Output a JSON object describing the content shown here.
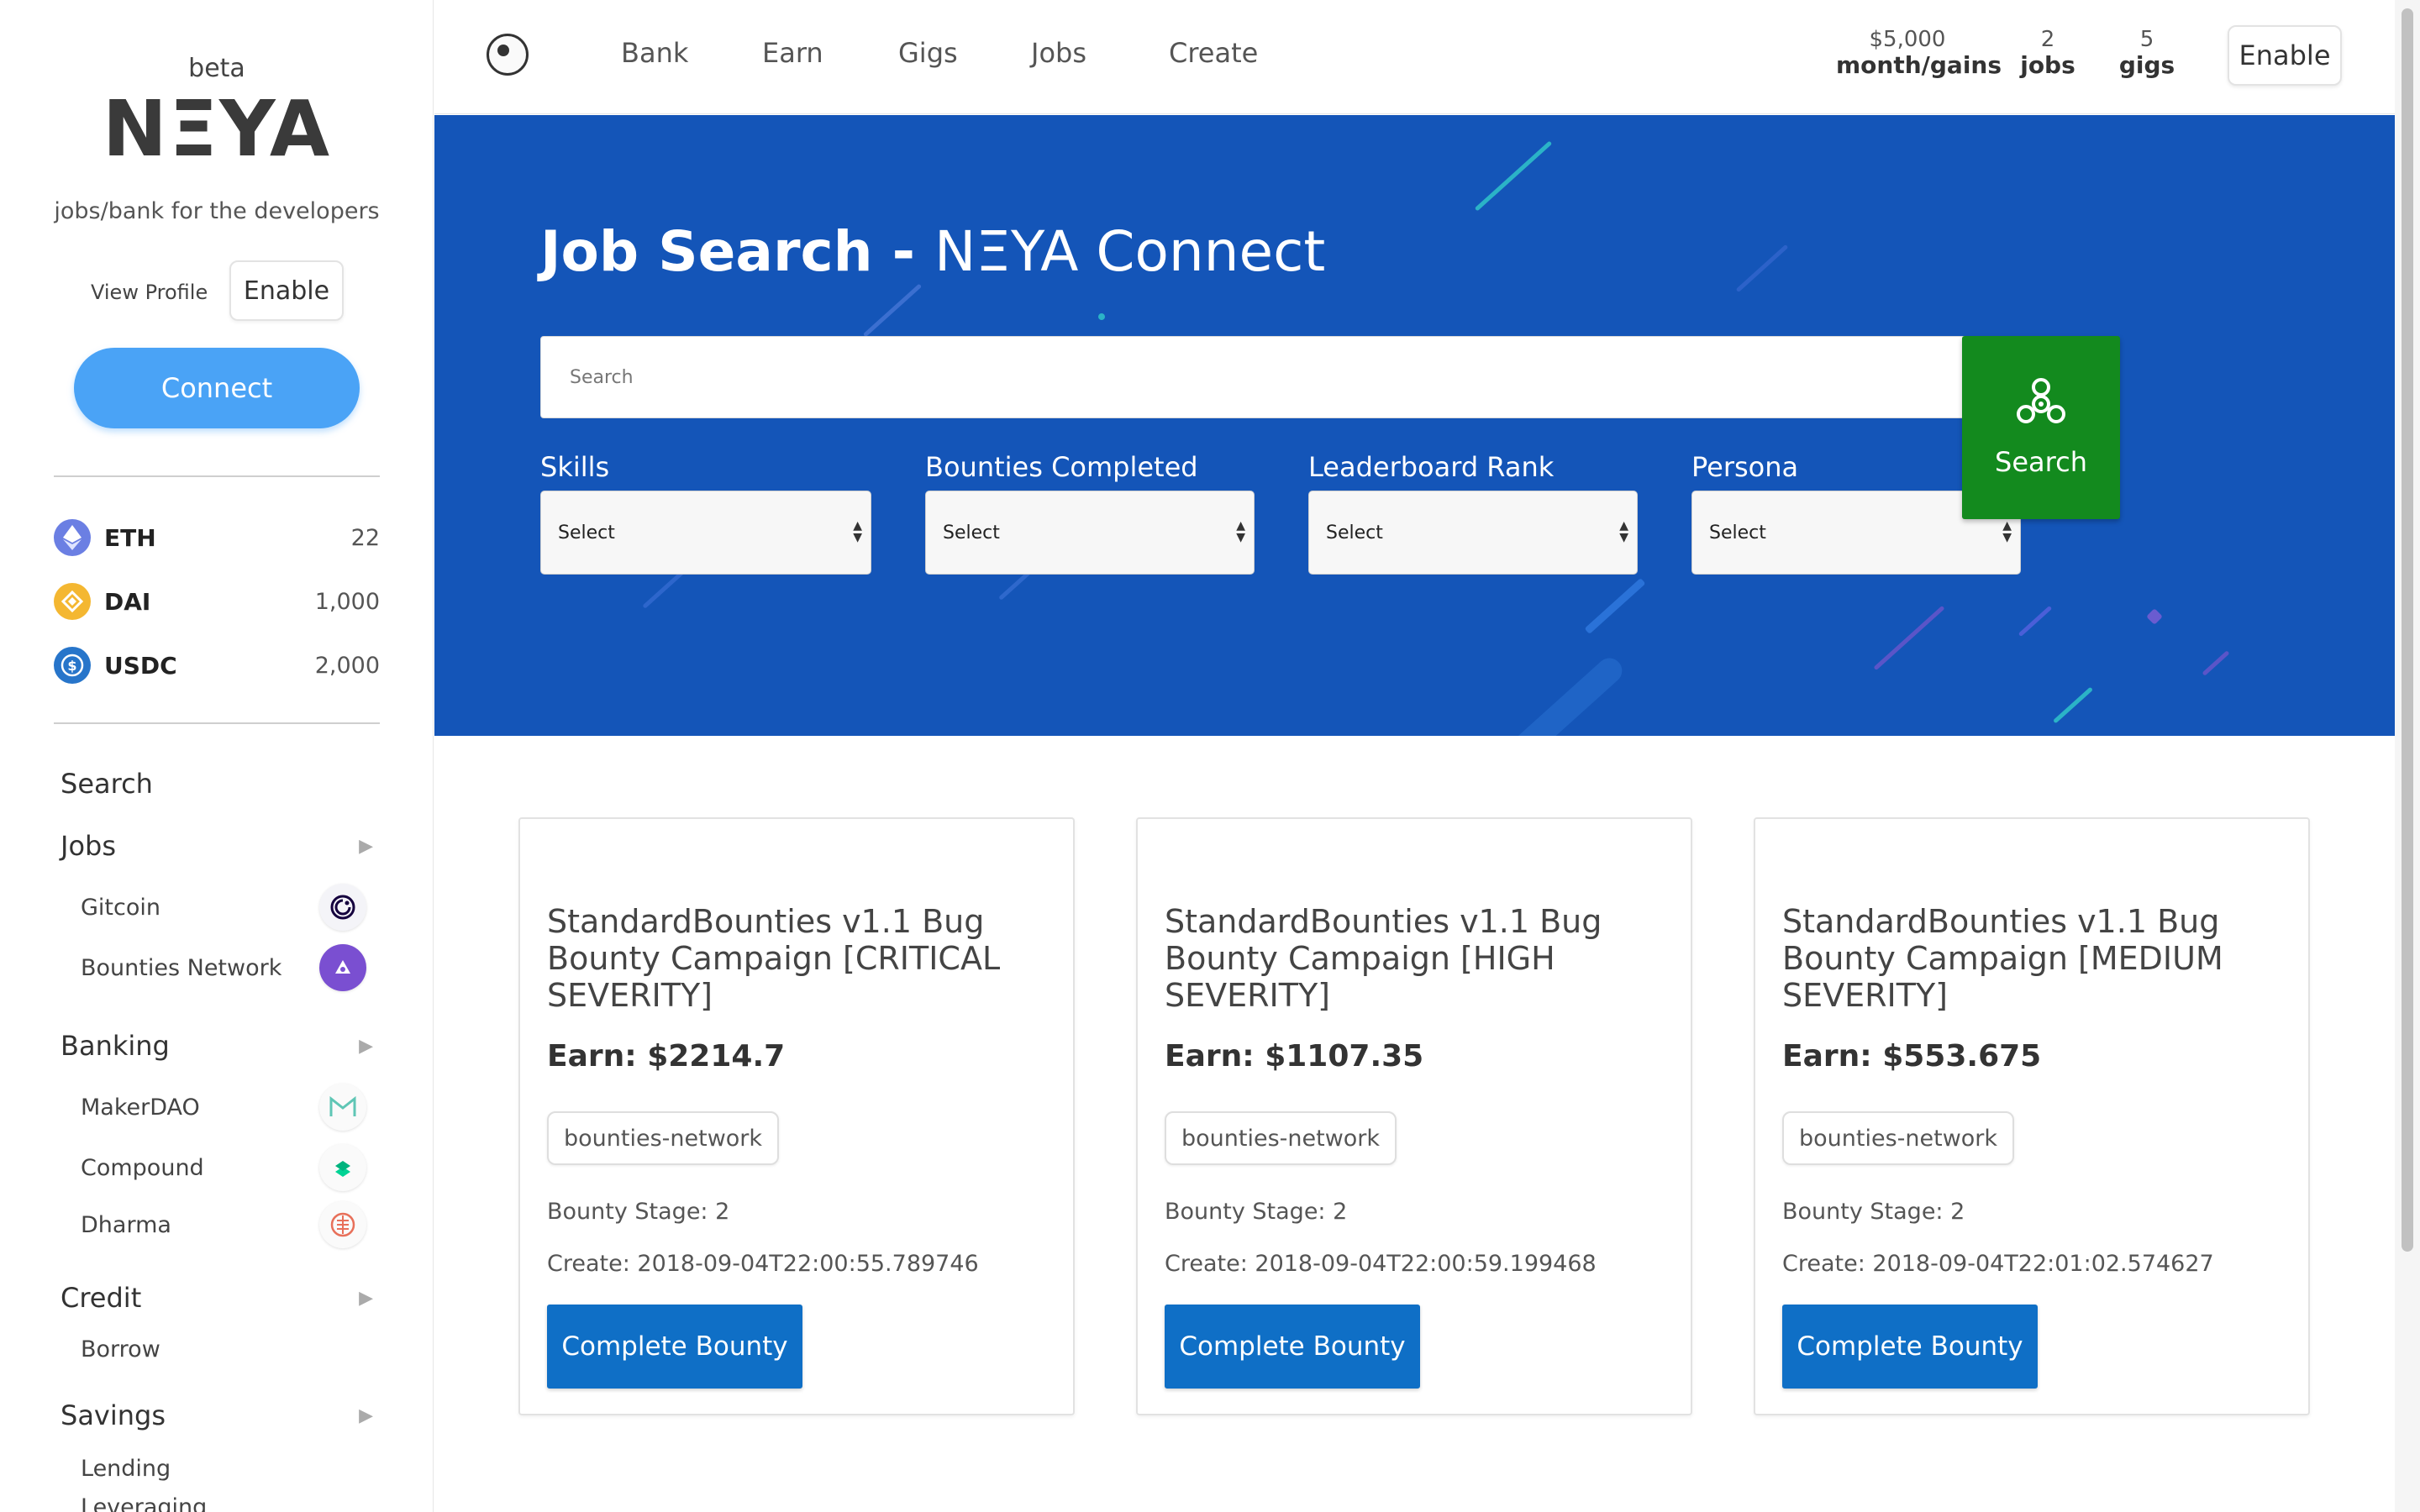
{
  "sidebar": {
    "beta": "beta",
    "logo": "NΞYA",
    "tagline": "jobs/bank for the developers",
    "view_profile": "View Profile",
    "enable": "Enable",
    "connect": "Connect",
    "assets": [
      {
        "name": "ETH",
        "value": "22",
        "icon": "eth-icon",
        "color": "#6b7fe3"
      },
      {
        "name": "DAI",
        "value": "1,000",
        "icon": "dai-icon",
        "color": "#f4b731"
      },
      {
        "name": "USDC",
        "value": "2,000",
        "icon": "usdc-icon",
        "color": "#2775ca"
      }
    ],
    "nav": {
      "search": "Search",
      "jobs": "Jobs",
      "gitcoin": "Gitcoin",
      "bounties_network": "Bounties Network",
      "banking": "Banking",
      "makerdao": "MakerDAO",
      "compound": "Compound",
      "dharma": "Dharma",
      "credit": "Credit",
      "borrow": "Borrow",
      "savings": "Savings",
      "lending": "Lending",
      "leveraging": "Leveraging"
    },
    "arrow": "▶"
  },
  "topbar": {
    "links": [
      "Bank",
      "Earn",
      "Gigs",
      "Jobs",
      "Create"
    ],
    "stats": [
      {
        "value": "$5,000",
        "label": "month/gains"
      },
      {
        "value": "2",
        "label": "jobs"
      },
      {
        "value": "5",
        "label": "gigs"
      }
    ],
    "enable": "Enable"
  },
  "hero": {
    "title_strong": "Job Search -",
    "title_light": "NΞYA Connect",
    "search_placeholder": "Search",
    "search_button": "Search",
    "filters": [
      {
        "label": "Skills",
        "value": "Select"
      },
      {
        "label": "Bounties Completed",
        "value": "Select"
      },
      {
        "label": "Leaderboard Rank",
        "value": "Select"
      },
      {
        "label": "Persona",
        "value": "Select"
      }
    ],
    "colors": {
      "background": "#1455b8",
      "search_button": "#138a1e"
    }
  },
  "cards": [
    {
      "title": "StandardBounties v1.1 Bug Bounty Campaign [CRITICAL SEVERITY]",
      "earn": "Earn: $2214.7",
      "tag": "bounties-network",
      "stage": "Bounty Stage: 2",
      "create": "Create: 2018-09-04T22:00:55.789746",
      "button": "Complete Bounty"
    },
    {
      "title": "StandardBounties v1.1 Bug Bounty Campaign [HIGH SEVERITY]",
      "earn": "Earn: $1107.35",
      "tag": "bounties-network",
      "stage": "Bounty Stage: 2",
      "create": "Create: 2018-09-04T22:00:59.199468",
      "button": "Complete Bounty"
    },
    {
      "title": "StandardBounties v1.1 Bug Bounty Campaign [MEDIUM SEVERITY]",
      "earn": "Earn: $553.675",
      "tag": "bounties-network",
      "stage": "Bounty Stage: 2",
      "create": "Create: 2018-09-04T22:01:02.574627",
      "button": "Complete Bounty"
    }
  ]
}
